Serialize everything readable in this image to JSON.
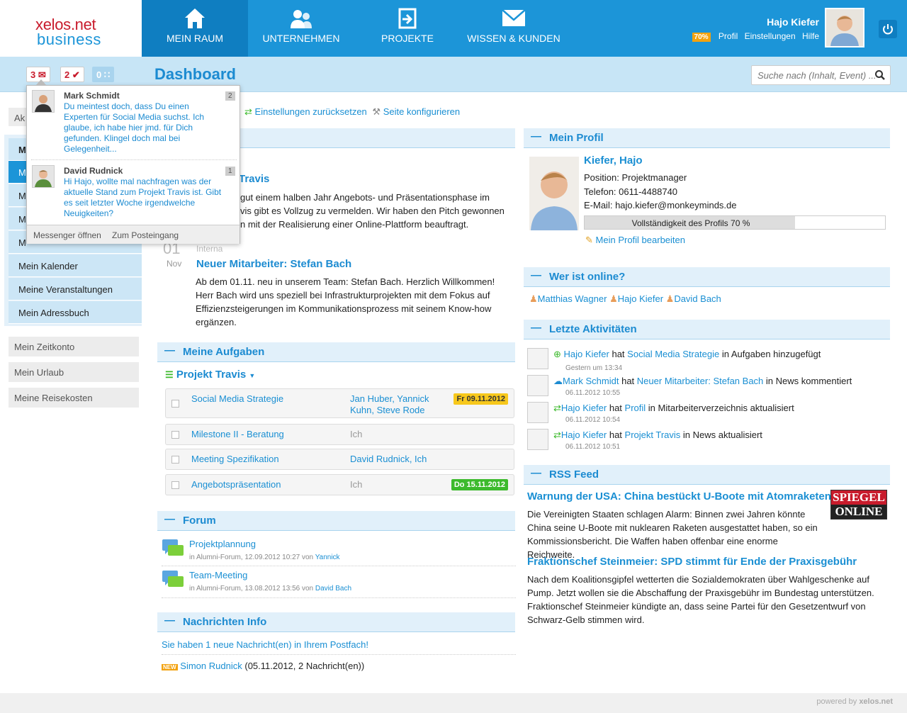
{
  "brand": {
    "line1": "xelos.net",
    "line2": "business"
  },
  "nav": [
    {
      "label": "MEIN RAUM",
      "icon": "home-icon"
    },
    {
      "label": "UNTERNEHMEN",
      "icon": "users-icon"
    },
    {
      "label": "PROJEKTE",
      "icon": "projects-icon"
    },
    {
      "label": "WISSEN & KUNDEN",
      "icon": "mail-icon"
    }
  ],
  "user": {
    "name": "Hajo Kiefer",
    "percent": "70%",
    "links": [
      "Profil",
      "Einstellungen",
      "Hilfe"
    ]
  },
  "subbar": {
    "title": "Dashboard",
    "badge_messages": "3",
    "badge_tasks": "2",
    "badge_rss": "0",
    "search_placeholder": "Suche nach (Inhalt, Event) ..."
  },
  "popup": {
    "messages": [
      {
        "name": "Mark Schmidt",
        "count": "2",
        "text": "Du meintest doch, dass Du einen Experten für Social Media suchst. Ich glaube, ich habe hier jmd. für Dich gefunden. Klingel doch mal bei Gelegenheit..."
      },
      {
        "name": "David Rudnick",
        "count": "1",
        "text": "Hi Hajo, wollte mal nachfragen was der aktuelle Stand zum Projekt Travis ist. Gibt es seit letzter Woche irgendwelche Neuigkeiten?"
      }
    ],
    "footer_open": "Messenger öffnen",
    "footer_inbox": "Zum Posteingang"
  },
  "sidebar": {
    "top_partial": "Ak",
    "items": [
      "M",
      "M",
      "M",
      "M",
      "M",
      "Mein Kalender",
      "Meine Veranstaltungen",
      "Mein Adressbuch"
    ],
    "grey_items": [
      "Mein Zeitkonto",
      "Mein Urlaub",
      "Meine Reisekosten"
    ]
  },
  "toolbar": {
    "reset": "Einstellungen zurücksetzen",
    "configure": "Seite konfigurieren"
  },
  "news": {
    "item1_title_partial": "Travis",
    "item1_text": [
      "gut einem halben Jahr Angebots- und Präsentationsphase im",
      "vis gibt es Vollzug zu vermelden. Wir haben den Pitch gewonnen",
      "n mit der Realisierung einer Online-Plattform beauftragt."
    ],
    "item2_day": "01",
    "item2_month": "Nov",
    "item2_cat": "Interna",
    "item2_title": "Neuer Mitarbeiter: Stefan Bach",
    "item2_text": "Ab dem 01.11. neu in unserem Team: Stefan Bach. Herzlich Willkommen! Herr Bach wird uns speziell bei Infrastrukturprojekten mit dem Fokus auf Effizienzsteigerungen im Kommunikationsprozess mit seinem Know-how ergänzen."
  },
  "tasks": {
    "title": "Meine Aufgaben",
    "project": "Projekt Travis",
    "rows": [
      {
        "name": "Social Media Strategie",
        "assignee": "Jan Huber, Yannick Kuhn, Steve Rode",
        "due": "Fr 09.11.2012"
      },
      {
        "name": "Milestone II - Beratung",
        "assignee": "Ich",
        "due": ""
      },
      {
        "name": "Meeting Spezifikation",
        "assignee": "David Rudnick, Ich",
        "due": ""
      },
      {
        "name": "Angebotspräsentation",
        "assignee": "Ich",
        "due": "Do 15.11.2012"
      }
    ]
  },
  "forum": {
    "title": "Forum",
    "threads": [
      {
        "title": "Projektplannung",
        "meta": "in Alumni-Forum, 12.09.2012 10:27 von",
        "author": "Yannick"
      },
      {
        "title": "Team-Meeting",
        "meta": "in Alumni-Forum, 13.08.2012 13:56 von",
        "author": "David Bach"
      }
    ]
  },
  "messages_info": {
    "title": "Nachrichten Info",
    "new_msg": "Sie haben 1 neue Nachricht(en) in Ihrem Postfach!",
    "new_tag": "NEW",
    "sender": "Simon Rudnick",
    "sender_meta": "(05.11.2012, 2 Nachricht(en))"
  },
  "profile": {
    "title": "Mein Profil",
    "name": "Kiefer, Hajo",
    "position": "Position: Projektmanager",
    "phone": "Telefon: 0611-4488740",
    "email_label": "E-Mail: ",
    "email": "hajo.kiefer@monkeyminds.de",
    "completeness": "Vollständigkeit des Profils 70 %",
    "completeness_value": 70,
    "edit": "Mein Profil bearbeiten"
  },
  "online": {
    "title": "Wer ist online?",
    "users": [
      "Matthias Wagner",
      "Hajo Kiefer",
      "David Bach"
    ]
  },
  "activities": {
    "title": "Letzte Aktivitäten",
    "items": [
      {
        "actor": "Hajo Kiefer",
        "verb": "hat",
        "object": "Social Media Strategie",
        "rest": "in Aufgaben hinzugefügt",
        "time": "Gestern um 13:34"
      },
      {
        "actor": "Mark Schmidt",
        "verb": "hat",
        "object": "Neuer Mitarbeiter: Stefan Bach",
        "rest": "in News kommentiert",
        "time": "06.11.2012 10:55"
      },
      {
        "actor": "Hajo Kiefer",
        "verb": "hat",
        "object": "Profil",
        "rest": "in Mitarbeiterverzeichnis aktualisiert",
        "time": "06.11.2012 10:54"
      },
      {
        "actor": "Hajo Kiefer",
        "verb": "hat",
        "object": "Projekt Travis",
        "rest": "in News aktualisiert",
        "time": "06.11.2012 10:51"
      }
    ]
  },
  "rss": {
    "title": "RSS Feed",
    "logo_top": "SPIEGEL",
    "logo_bottom": "ONLINE",
    "items": [
      {
        "title": "Warnung der USA: China bestückt U-Boote mit Atomraketen",
        "text": "Die Vereinigten Staaten schlagen Alarm: Binnen zwei Jahren könnte China seine U-Boote mit nuklearen Raketen ausgestattet haben, so ein Kommissionsbericht. Die Waffen haben offenbar eine enorme Reichweite."
      },
      {
        "title": "Fraktionschef Steinmeier: SPD stimmt für Ende der Praxisgebühr",
        "text": "Nach dem Koalitionsgipfel wetterten die Sozialdemokraten über Wahlgeschenke auf Pump. Jetzt wollen sie die Abschaffung der Praxisgebühr im Bundestag unterstützen. Fraktionschef Steinmeier kündigte an, dass seine Partei für den Gesetzentwurf von Schwarz-Gelb stimmen wird."
      }
    ]
  },
  "footer": {
    "powered": "powered by",
    "brand": "xelos.net"
  },
  "colors": {
    "primary": "#1c95d8",
    "active": "#0f7ec1",
    "accent": "#f3a20f",
    "due_yellow": "#f7c81c",
    "due_green": "#3cba2c"
  }
}
